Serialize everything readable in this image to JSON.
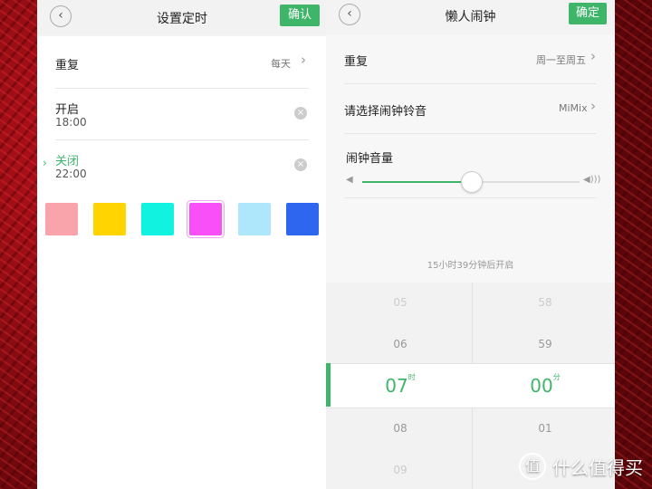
{
  "left": {
    "title": "设置定时",
    "confirm": "确认",
    "repeat_label": "重复",
    "repeat_value": "每天",
    "on_label": "开启",
    "on_time": "18:00",
    "off_label": "关闭",
    "off_time": "22:00",
    "swatches": [
      "#f9a3ab",
      "#ffd400",
      "#12f2e0",
      "#f94ff6",
      "#aee7fb",
      "#2f66f0"
    ]
  },
  "right": {
    "title": "懒人闹钟",
    "confirm": "确定",
    "repeat_label": "重复",
    "repeat_value": "周一至周五",
    "ringtone_label": "请选择闹钟铃音",
    "ringtone_value": "MiMix",
    "volume_label": "闹钟音量",
    "volume_level": 0.5,
    "countdown": "15小时39分钟后开启",
    "hours": [
      "05",
      "06",
      "07",
      "08",
      "09"
    ],
    "hour_unit": "时",
    "minutes": [
      "58",
      "59",
      "00",
      "01"
    ],
    "minute_unit": "分"
  },
  "watermark": "值 什么值得买"
}
